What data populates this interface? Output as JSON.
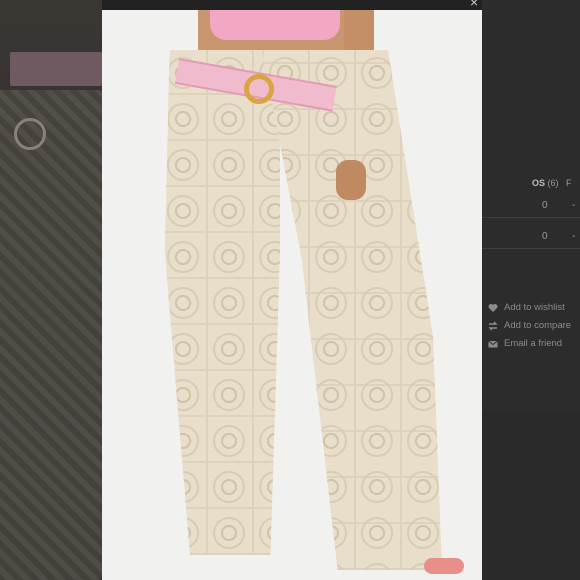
{
  "close_glyph": "×",
  "size_header": {
    "label": "OS",
    "count": "(6)",
    "next_col": "F"
  },
  "quantities": [
    {
      "value": "0",
      "dash": "-"
    },
    {
      "value": "0",
      "dash": "-"
    }
  ],
  "actions": [
    {
      "label": "Add to wishlist",
      "icon": "heart-icon"
    },
    {
      "label": "Add to compare",
      "icon": "compare-icon"
    },
    {
      "label": "Email a friend",
      "icon": "envelope-icon"
    }
  ],
  "colors": {
    "overlay": "#222222",
    "photo_bg": "#f1f1ef",
    "pants": "#e8dec9",
    "belt": "#f0bccd",
    "buckle": "#d9a441"
  }
}
